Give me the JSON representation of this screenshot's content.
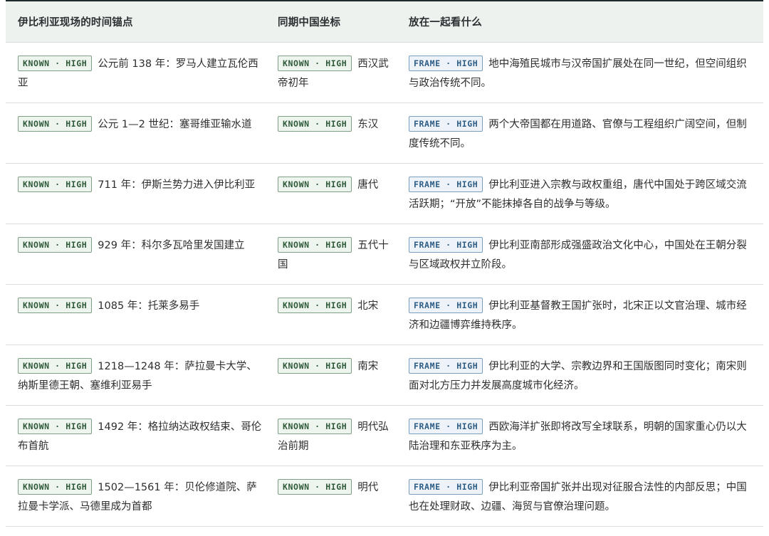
{
  "headers": {
    "col1": "伊比利亚现场的时间锚点",
    "col2": "同期中国坐标",
    "col3": "放在一起看什么"
  },
  "badges": {
    "known": "KNOWN · HIGH",
    "frame": "FRAME · HIGH"
  },
  "rows": [
    {
      "anchor": "公元前 138 年：罗马人建立瓦伦西亚",
      "china": "西汉武帝初年",
      "note": "地中海殖民城市与汉帝国扩展处在同一世纪，但空间组织与政治传统不同。"
    },
    {
      "anchor": "公元 1—2 世纪：塞哥维亚输水道",
      "china": "东汉",
      "note": "两个大帝国都在用道路、官僚与工程组织广阔空间，但制度传统不同。"
    },
    {
      "anchor": "711 年：伊斯兰势力进入伊比利亚",
      "china": "唐代",
      "note": "伊比利亚进入宗教与政权重组，唐代中国处于跨区域交流活跃期；“开放”不能抹掉各自的战争与等级。"
    },
    {
      "anchor": "929 年：科尔多瓦哈里发国建立",
      "china": "五代十国",
      "note": "伊比利亚南部形成强盛政治文化中心，中国处在王朝分裂与区域政权并立阶段。"
    },
    {
      "anchor": "1085 年：托莱多易手",
      "china": "北宋",
      "note": "伊比利亚基督教王国扩张时，北宋正以文官治理、城市经济和边疆博弈维持秩序。"
    },
    {
      "anchor": "1218—1248 年：萨拉曼卡大学、纳斯里德王朝、塞维利亚易手",
      "china": "南宋",
      "note": "伊比利亚的大学、宗教边界和王国版图同时变化；南宋则面对北方压力并发展高度城市化经济。"
    },
    {
      "anchor": "1492 年：格拉纳达政权结束、哥伦布首航",
      "china": "明代弘治前期",
      "note": "西欧海洋扩张即将改写全球联系，明朝的国家重心仍以大陆治理和东亚秩序为主。"
    },
    {
      "anchor": "1502—1561 年：贝伦修道院、萨拉曼卡学派、马德里成为首都",
      "china": "明代",
      "note": "伊比利亚帝国扩张并出现对征服合法性的内部反思；中国也在处理财政、边疆、海贸与官僚治理问题。"
    }
  ]
}
